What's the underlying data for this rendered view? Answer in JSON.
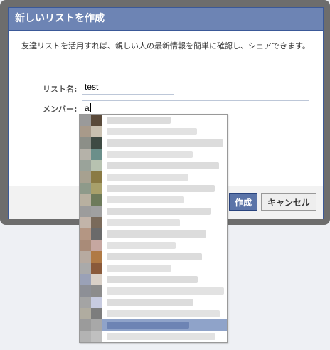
{
  "dialog": {
    "title": "新しいリストを作成",
    "intro": "友達リストを活用すれば、親しい人の最新情報を簡単に確認し、シェアできます。",
    "list_name_label": "リスト名:",
    "list_name_value": "test",
    "members_label": "メンバー:",
    "members_value": "a",
    "create_button": "作成",
    "cancel_button": "キャンセル"
  },
  "colors": {
    "header": "#6d84b4",
    "header_border": "#3b5998",
    "primary_button": "#5b74a8"
  },
  "suggestions_count": 20
}
